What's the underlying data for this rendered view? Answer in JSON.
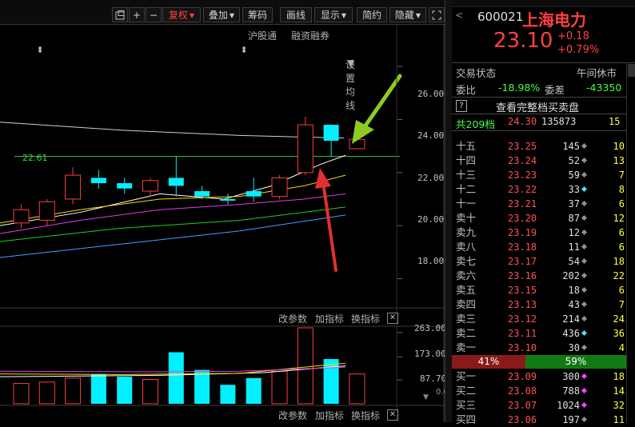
{
  "toolbar": {
    "buttons": [
      "+",
      "−"
    ],
    "fuquan": "复权",
    "diejia": "叠加",
    "chouma": "筹码",
    "huaxian": "画线",
    "xianshi": "显示",
    "jianyue": "简约",
    "yincang": "隐藏"
  },
  "chart_links": {
    "hgt": "沪股通",
    "rzrq": "融资融券",
    "settings": "设置均线"
  },
  "kline": {
    "y_ticks": [
      "26.00",
      "24.00",
      "22.00",
      "20.00",
      "18.00"
    ],
    "ref_line_label": "22.61",
    "ref_line_value": 22.61,
    "ylim": [
      16.9,
      27.6
    ]
  },
  "volume": {
    "controls": {
      "params": "改参数",
      "add": "加指标",
      "switch": "换指标"
    },
    "y_ticks": [
      "263.00",
      "173.00",
      "87.70"
    ],
    "side_label": "0.0"
  },
  "bottom_controls": {
    "params": "改参数",
    "add": "加指标",
    "switch": "换指标"
  },
  "chart_data": [
    {
      "type": "candlestick",
      "ylim": [
        16.9,
        27.6
      ],
      "ref_line": 22.61,
      "candles": [
        {
          "o": 20.1,
          "c": 20.6,
          "h": 20.8,
          "l": 19.9,
          "color": "red"
        },
        {
          "o": 20.2,
          "c": 20.9,
          "h": 21.0,
          "l": 20.0,
          "color": "red"
        },
        {
          "o": 21.0,
          "c": 21.9,
          "h": 22.2,
          "l": 20.8,
          "color": "red"
        },
        {
          "o": 21.8,
          "c": 21.6,
          "h": 22.1,
          "l": 21.4,
          "color": "cyan"
        },
        {
          "o": 21.6,
          "c": 21.4,
          "h": 21.8,
          "l": 21.2,
          "color": "cyan"
        },
        {
          "o": 21.3,
          "c": 21.7,
          "h": 21.8,
          "l": 21.1,
          "color": "red"
        },
        {
          "o": 21.8,
          "c": 21.5,
          "h": 22.6,
          "l": 21.1,
          "color": "cyan"
        },
        {
          "o": 21.3,
          "c": 21.1,
          "h": 21.5,
          "l": 21.0,
          "color": "cyan"
        },
        {
          "o": 21.0,
          "c": 21.0,
          "h": 21.2,
          "l": 20.8,
          "color": "cyan"
        },
        {
          "o": 21.3,
          "c": 21.1,
          "h": 21.8,
          "l": 20.9,
          "color": "cyan"
        },
        {
          "o": 21.1,
          "c": 21.8,
          "h": 21.9,
          "l": 21.0,
          "color": "red"
        },
        {
          "o": 22.0,
          "c": 23.8,
          "h": 24.1,
          "l": 21.9,
          "color": "red"
        },
        {
          "o": 23.8,
          "c": 23.2,
          "h": 23.8,
          "l": 22.6,
          "color": "cyan"
        },
        {
          "o": 22.9,
          "c": 23.25,
          "h": 23.6,
          "l": 22.9,
          "color": "red"
        }
      ],
      "ma": [
        {
          "color": "#d0d0d0",
          "values": [
            [
              0,
              23.9
            ],
            [
              150,
              23.6
            ],
            [
              300,
              23.4
            ],
            [
              430,
              23.3
            ]
          ]
        },
        {
          "color": "#ffffff",
          "values": [
            [
              0,
              20.0
            ],
            [
              100,
              20.5
            ],
            [
              200,
              21.2
            ],
            [
              280,
              21.0
            ],
            [
              340,
              21.5
            ],
            [
              400,
              22.3
            ],
            [
              432,
              22.65
            ]
          ]
        },
        {
          "color": "#ffd700",
          "values": [
            [
              0,
              20.1
            ],
            [
              100,
              20.6
            ],
            [
              200,
              21.0
            ],
            [
              300,
              21.1
            ],
            [
              380,
              21.5
            ],
            [
              432,
              21.9
            ]
          ]
        },
        {
          "color": "#e040e0",
          "values": [
            [
              0,
              19.7
            ],
            [
              100,
              20.2
            ],
            [
              200,
              20.6
            ],
            [
              300,
              20.8
            ],
            [
              380,
              21.0
            ],
            [
              432,
              21.2
            ]
          ]
        },
        {
          "color": "#20d020",
          "values": [
            [
              0,
              19.4
            ],
            [
              150,
              19.9
            ],
            [
              300,
              20.2
            ],
            [
              432,
              20.7
            ]
          ]
        },
        {
          "color": "#40a0ff",
          "values": [
            [
              0,
              18.8
            ],
            [
              150,
              19.3
            ],
            [
              300,
              19.8
            ],
            [
              432,
              20.4
            ]
          ]
        }
      ]
    },
    {
      "type": "bar",
      "ylim": [
        0,
        280
      ],
      "values": [
        75,
        80,
        95,
        110,
        100,
        90,
        190,
        125,
        70,
        95,
        120,
        280,
        165,
        110
      ],
      "colors": [
        "red",
        "red",
        "red",
        "cyan",
        "cyan",
        "red",
        "cyan",
        "cyan",
        "cyan",
        "cyan",
        "red",
        "red",
        "cyan",
        "red"
      ],
      "lines": [
        {
          "color": "#ffffff",
          "values": [
            [
              0,
              100
            ],
            [
              200,
              105
            ],
            [
              330,
              115
            ],
            [
              432,
              140
            ]
          ]
        },
        {
          "color": "#ffd700",
          "values": [
            [
              0,
              110
            ],
            [
              150,
              108
            ],
            [
              300,
              112
            ],
            [
              432,
              150
            ]
          ]
        },
        {
          "color": "#e040e0",
          "values": [
            [
              0,
              120
            ],
            [
              200,
              118
            ],
            [
              300,
              120
            ],
            [
              432,
              135
            ]
          ]
        }
      ]
    }
  ],
  "quote": {
    "code": "600021",
    "name": "上海电力",
    "price": "23.10",
    "change": "+0.18",
    "change_pct": "+0.79%",
    "status_label": "交易状态",
    "status_value": "午间休市",
    "weibi_label": "委比",
    "weibi_value": "-18.98%",
    "weicha_label": "委差",
    "weicha_value": "-43350",
    "full_book": "查看完整档买卖盘",
    "total_label": "共209档",
    "total_price": "24.30",
    "total_vol": "135873",
    "total_cnt": "15",
    "help_icon": "?",
    "ratio_buy": "41%",
    "ratio_sell": "59%",
    "asks": [
      {
        "label": "十五",
        "price": "23.25",
        "vol": "145",
        "cnt": "10",
        "dot": "#909090"
      },
      {
        "label": "十四",
        "price": "23.24",
        "vol": "52",
        "cnt": "13",
        "dot": "#909090"
      },
      {
        "label": "十三",
        "price": "23.23",
        "vol": "59",
        "cnt": "7",
        "dot": "#909090"
      },
      {
        "label": "十二",
        "price": "23.22",
        "vol": "33",
        "cnt": "8",
        "dot": "#40e0ff"
      },
      {
        "label": "十一",
        "price": "23.21",
        "vol": "37",
        "cnt": "6",
        "dot": "#909090"
      },
      {
        "label": "卖十",
        "price": "23.20",
        "vol": "87",
        "cnt": "12",
        "dot": "#909090"
      },
      {
        "label": "卖九",
        "price": "23.19",
        "vol": "12",
        "cnt": "6",
        "dot": "#909090"
      },
      {
        "label": "卖八",
        "price": "23.18",
        "vol": "11",
        "cnt": "6",
        "dot": "#909090"
      },
      {
        "label": "卖七",
        "price": "23.17",
        "vol": "54",
        "cnt": "18",
        "dot": "#909090"
      },
      {
        "label": "卖六",
        "price": "23.16",
        "vol": "202",
        "cnt": "22",
        "dot": "#909090"
      },
      {
        "label": "卖五",
        "price": "23.15",
        "vol": "18",
        "cnt": "6",
        "dot": "#909090"
      },
      {
        "label": "卖四",
        "price": "23.13",
        "vol": "43",
        "cnt": "7",
        "dot": "#909090"
      },
      {
        "label": "卖三",
        "price": "23.12",
        "vol": "214",
        "cnt": "24",
        "dot": "#909090"
      },
      {
        "label": "卖二",
        "price": "23.11",
        "vol": "436",
        "cnt": "36",
        "dot": "#40e0ff"
      },
      {
        "label": "卖一",
        "price": "23.10",
        "vol": "30",
        "cnt": "4",
        "dot": "#909090"
      }
    ],
    "bids": [
      {
        "label": "买一",
        "price": "23.09",
        "vol": "300",
        "cnt": "18",
        "dot": "#ff40ff"
      },
      {
        "label": "买二",
        "price": "23.08",
        "vol": "788",
        "cnt": "14",
        "dot": "#ff40ff"
      },
      {
        "label": "买三",
        "price": "23.07",
        "vol": "1024",
        "cnt": "32",
        "dot": "#ff40ff"
      },
      {
        "label": "买四",
        "price": "23.06",
        "vol": "197",
        "cnt": "11",
        "dot": "#909090"
      }
    ]
  },
  "colors": {
    "up": "#ff3c3c",
    "down": "#00f0ff",
    "ref": "#30c030",
    "buyBar": "#a01818",
    "sellBar": "#108010"
  }
}
